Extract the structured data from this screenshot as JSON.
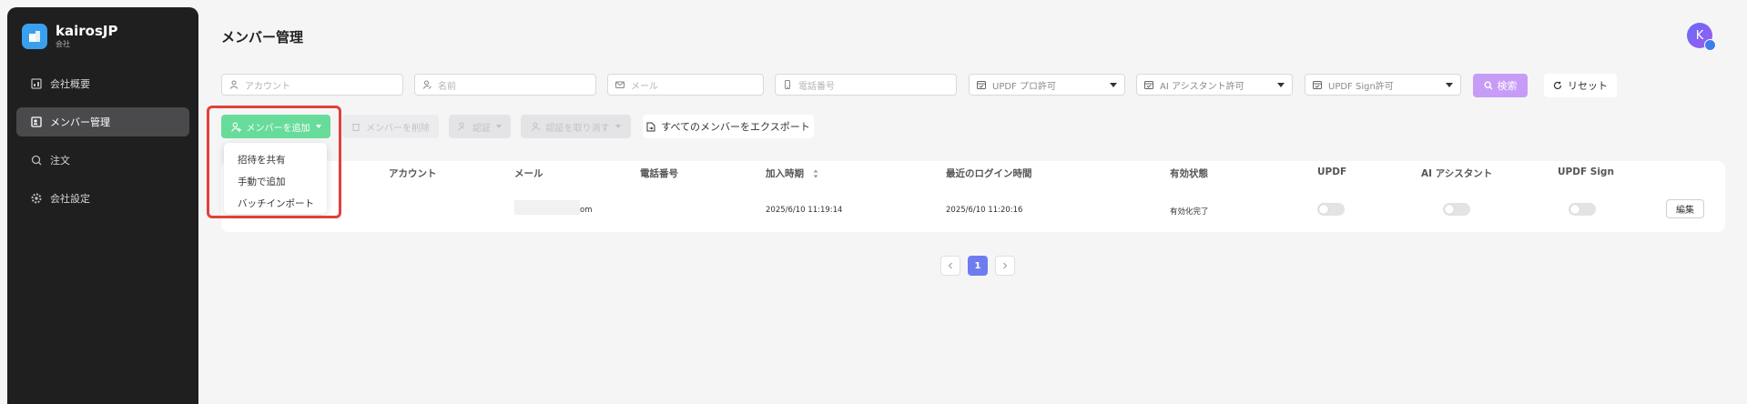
{
  "brand": {
    "name": "kairosJP",
    "subtitle": "会社"
  },
  "sidebar": {
    "items": [
      {
        "label": "会社概要",
        "icon": "dashboard-icon"
      },
      {
        "label": "メンバー管理",
        "icon": "members-icon",
        "active": true
      },
      {
        "label": "注文",
        "icon": "orders-icon"
      },
      {
        "label": "会社設定",
        "icon": "gear-icon"
      }
    ]
  },
  "header": {
    "title": "メンバー管理",
    "avatar_initial": "K"
  },
  "filters": {
    "account_placeholder": "アカウント",
    "name_placeholder": "名前",
    "email_placeholder": "メール",
    "phone_placeholder": "電話番号",
    "updf_pro_license": "UPDF プロ許可",
    "ai_assistant_license": "AI アシスタント許可",
    "updf_sign_license": "UPDF Sign許可",
    "search_label": "検索",
    "reset_label": "リセット"
  },
  "actions": {
    "add_member": "メンバーを追加",
    "delete_member": "メンバーを削除",
    "authorize": "認証",
    "revoke_authorization": "認証を取り消す",
    "export_all": "すべてのメンバーをエクスポート"
  },
  "add_menu": {
    "items": [
      "招待を共有",
      "手動で追加",
      "バッチインポート"
    ]
  },
  "table": {
    "columns": [
      "アカウント",
      "メール",
      "電話番号",
      "加入時期",
      "最近のログイン時間",
      "有効状態",
      "UPDF",
      "AI アシスタント",
      "UPDF Sign"
    ],
    "rows": [
      {
        "email_suffix": "om",
        "phone": "",
        "joined": "2025/6/10 11:19:14",
        "last_login": "2025/6/10 11:20:16",
        "status": "有効化完了",
        "updf": false,
        "ai_assistant": false,
        "updf_sign": false,
        "edit_label": "編集"
      }
    ]
  },
  "pagination": {
    "current_page": "1"
  },
  "colors": {
    "accent_green": "#67dc9a",
    "search_purple": "#c79cf7",
    "page_active": "#6f7cf0",
    "highlight_red": "#e0413a"
  }
}
